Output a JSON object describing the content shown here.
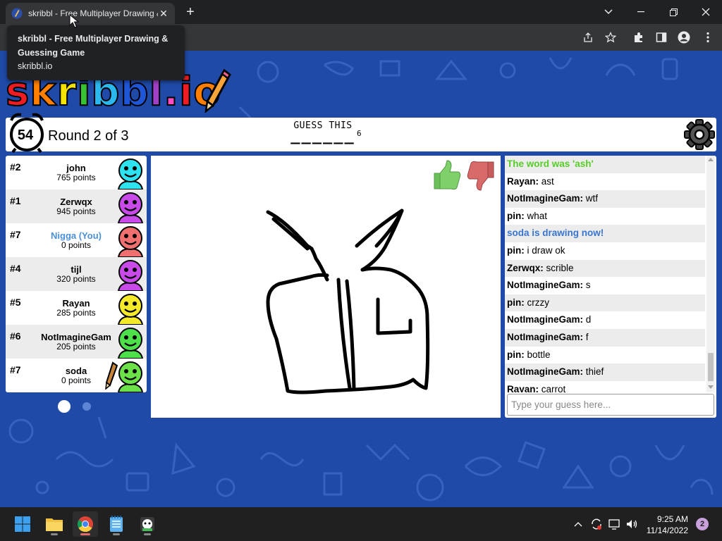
{
  "browser": {
    "tab_title": "skribbl - Free Multiplayer Drawing & Guessing Game",
    "tooltip": {
      "title": "skribbl - Free Multiplayer Drawing & Guessing Game",
      "url": "skribbl.io"
    },
    "new_tab": "+",
    "close_tab": "✕"
  },
  "logo": {
    "letters": [
      "s",
      "k",
      "r",
      "i",
      "b",
      "b",
      "l",
      ".",
      "i",
      "o"
    ],
    "colors": [
      "#ef1c24",
      "#ff7f00",
      "#f5e400",
      "#37c22f",
      "#2bb8ee",
      "#1f56d8",
      "#a03fc8",
      "#ff4dc1",
      "#ef1c24",
      "#ff7f00"
    ]
  },
  "header": {
    "timer": "54",
    "round": "Round 2 of 3",
    "guess_label": "GUESS THIS",
    "word_blanks": "______",
    "word_length": "6"
  },
  "players": [
    {
      "rank": "#2",
      "name": "john",
      "points": "765 points",
      "color": "#2ee3f0",
      "you": false,
      "drawing": false
    },
    {
      "rank": "#1",
      "name": "Zerwqx",
      "points": "945 points",
      "color": "#c84ae8",
      "you": false,
      "drawing": false
    },
    {
      "rank": "#7",
      "name": "Nigga (You)",
      "points": "0 points",
      "color": "#f07070",
      "you": true,
      "drawing": false
    },
    {
      "rank": "#4",
      "name": "tijl",
      "points": "320 points",
      "color": "#c84ae8",
      "you": false,
      "drawing": false
    },
    {
      "rank": "#5",
      "name": "Rayan",
      "points": "285 points",
      "color": "#f5ea2a",
      "you": false,
      "drawing": false
    },
    {
      "rank": "#6",
      "name": "NotImagineGam",
      "points": "205 points",
      "color": "#4de04a",
      "you": false,
      "drawing": false
    },
    {
      "rank": "#7",
      "name": "soda",
      "points": "0 points",
      "color": "#6ce048",
      "you": false,
      "drawing": true
    }
  ],
  "chat": {
    "messages": [
      {
        "type": "system-green",
        "text": "The word was 'ash'"
      },
      {
        "type": "msg",
        "user": "Rayan:",
        "text": " ast"
      },
      {
        "type": "msg",
        "user": "NotImagineGam:",
        "text": " wtf"
      },
      {
        "type": "msg",
        "user": "pin:",
        "text": " what"
      },
      {
        "type": "system-blue",
        "text": "soda is drawing now!"
      },
      {
        "type": "msg",
        "user": "pin:",
        "text": " i draw ok"
      },
      {
        "type": "msg",
        "user": "Zerwqx:",
        "text": " scrible"
      },
      {
        "type": "msg",
        "user": "NotImagineGam:",
        "text": " s"
      },
      {
        "type": "msg",
        "user": "pin:",
        "text": " crzzy"
      },
      {
        "type": "msg",
        "user": "NotImagineGam:",
        "text": " d"
      },
      {
        "type": "msg",
        "user": "NotImagineGam:",
        "text": " f"
      },
      {
        "type": "msg",
        "user": "pin:",
        "text": " bottle"
      },
      {
        "type": "msg",
        "user": "NotImagineGam:",
        "text": " thief"
      },
      {
        "type": "msg",
        "user": "Rayan:",
        "text": " carrot"
      }
    ],
    "placeholder": "Type your guess here..."
  },
  "taskbar": {
    "time": "9:25 AM",
    "date": "11/14/2022",
    "notifications": "2"
  }
}
